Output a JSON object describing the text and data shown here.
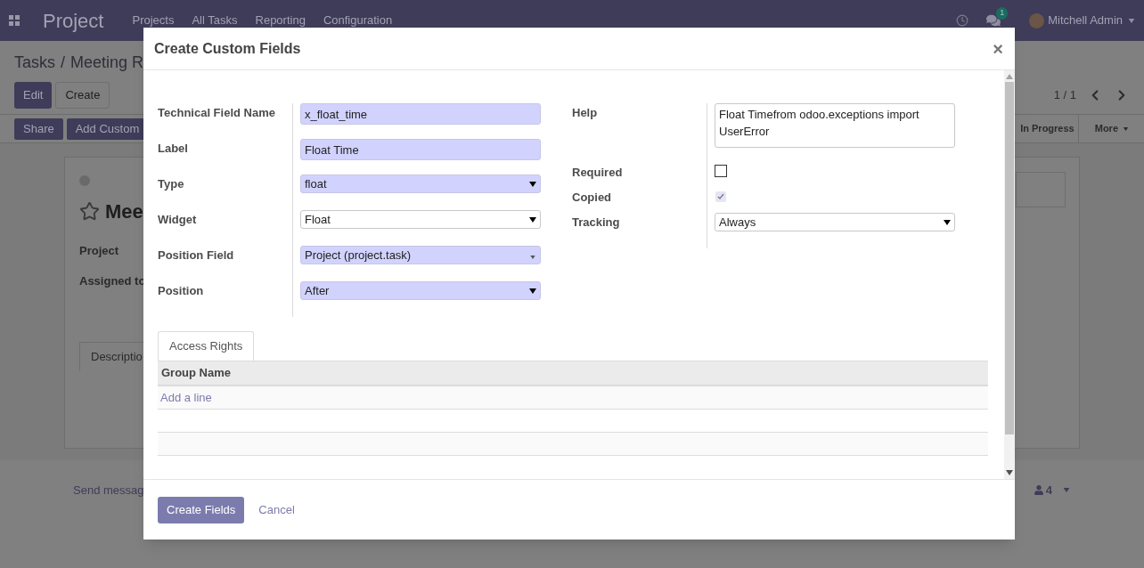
{
  "navbar": {
    "app_name": "Project",
    "menu": [
      "Projects",
      "All Tasks",
      "Reporting",
      "Configuration"
    ],
    "messages_badge": "1",
    "user_name": "Mitchell Admin"
  },
  "breadcrumb": {
    "parent": "Tasks",
    "separator": "/",
    "current": "Meeting R"
  },
  "buttons": [
    "Edit",
    "Create"
  ],
  "pager": "1 / 1",
  "status_bar": {
    "actions": [
      "Share",
      "Add Custom"
    ],
    "stage": "In Progress",
    "more": "More"
  },
  "record": {
    "title": "Mee",
    "starred": false,
    "fields": [
      "Project",
      "Assigned to"
    ],
    "tab": "Descriptio"
  },
  "chatter": {
    "send_message": "Send messag",
    "followers": "4"
  },
  "dialog": {
    "title": "Create Custom Fields",
    "close": "×",
    "left_fields": [
      {
        "label": "Technical Field Name",
        "kind": "text",
        "value": "x_float_time",
        "required": true
      },
      {
        "label": "Label",
        "kind": "text",
        "value": "Float Time",
        "required": true
      },
      {
        "label": "Type",
        "kind": "select",
        "value": "float",
        "required": true
      },
      {
        "label": "Widget",
        "kind": "select",
        "value": "Float",
        "required": false
      },
      {
        "label": "Position Field",
        "kind": "many2one",
        "value": "Project (project.task)",
        "required": true
      },
      {
        "label": "Position",
        "kind": "select",
        "value": "After",
        "required": true
      }
    ],
    "right_fields": [
      {
        "label": "Help",
        "kind": "textarea",
        "value": "Float Timefrom odoo.exceptions import UserError"
      },
      {
        "label": "Required",
        "kind": "checkbox",
        "checked": false,
        "disabled": false
      },
      {
        "label": "Copied",
        "kind": "checkbox",
        "checked": true,
        "disabled": true
      },
      {
        "label": "Tracking",
        "kind": "select",
        "value": "Always",
        "required": false
      }
    ],
    "tabs": [
      {
        "label": "Access Rights",
        "selected": true
      }
    ],
    "table": {
      "columns": [
        "Group Name"
      ],
      "add_line": "Add a line"
    },
    "buttons": [
      {
        "label": "Create Fields",
        "kind": "primary"
      },
      {
        "label": "Cancel",
        "kind": "link"
      }
    ]
  }
}
